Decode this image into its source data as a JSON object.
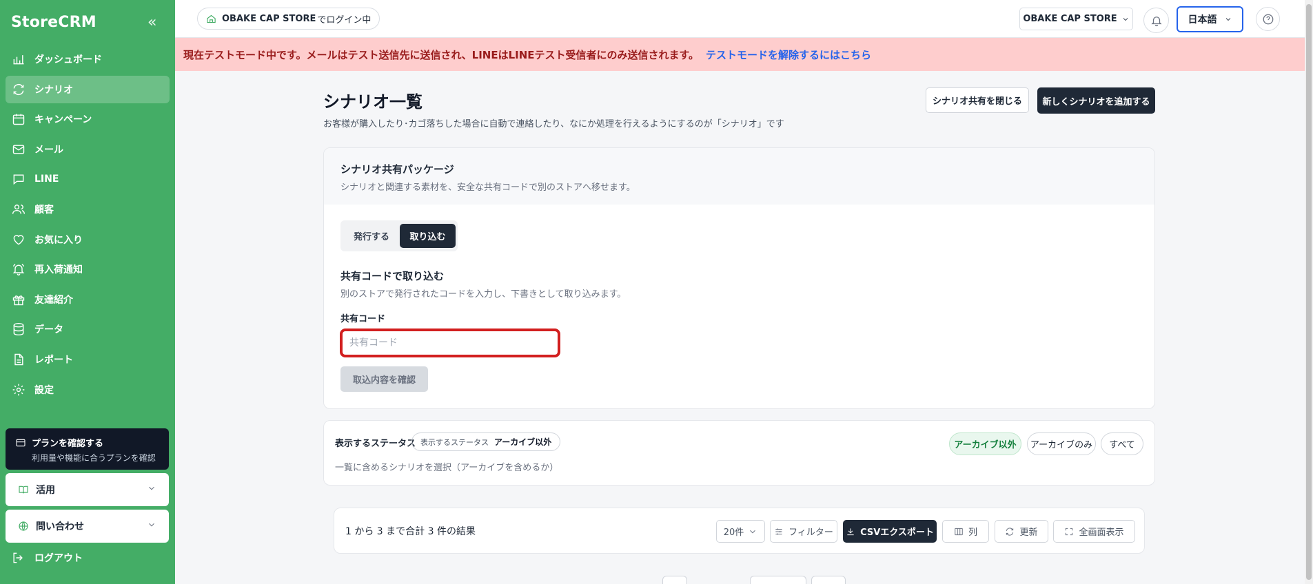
{
  "app": {
    "brand": "StoreCRM",
    "collapse_glyph": "«"
  },
  "sidebar": {
    "items": [
      {
        "label": "ダッシュボード",
        "icon": "bar-chart-icon"
      },
      {
        "label": "シナリオ",
        "icon": "refresh-icon",
        "active": true
      },
      {
        "label": "キャンペーン",
        "icon": "calendar-icon"
      },
      {
        "label": "メール",
        "icon": "mail-icon"
      },
      {
        "label": "LINE",
        "icon": "chat-icon"
      },
      {
        "label": "顧客",
        "icon": "users-icon"
      },
      {
        "label": "お気に入り",
        "icon": "heart-icon"
      },
      {
        "label": "再入荷通知",
        "icon": "bell-ring-icon"
      },
      {
        "label": "友達紹介",
        "icon": "gift-icon"
      },
      {
        "label": "データ",
        "icon": "database-icon"
      },
      {
        "label": "レポート",
        "icon": "file-icon"
      },
      {
        "label": "設定",
        "icon": "gear-icon"
      }
    ],
    "plan": {
      "title": "プランを確認する",
      "subtitle": "利用量や機能に合うプランを確認"
    },
    "usage": {
      "label": "活用"
    },
    "contact": {
      "label": "問い合わせ"
    },
    "logout": {
      "label": "ログアウト"
    }
  },
  "topbar": {
    "store_name": "OBAKE CAP STORE",
    "login_suffix": "でログイン中",
    "store_select": "OBAKE CAP STORE",
    "language": "日本語"
  },
  "banner": {
    "message": "現在テストモード中です。メールはテスト送信先に送信され、LINEはLINEテスト受信者にのみ送信されます。",
    "link": "テストモードを解除するにはこちら"
  },
  "page": {
    "title": "シナリオ一覧",
    "description": "お客様が購入したり･カゴ落ちした場合に自動で連絡したり、なにか処理を行えるようにするのが「シナリオ」です",
    "close_share_button": "シナリオ共有を閉じる",
    "add_button": "新しくシナリオを追加する"
  },
  "share_package": {
    "title": "シナリオ共有パッケージ",
    "subtitle": "シナリオと関連する素材を、安全な共有コードで別のストアへ移せます。",
    "tabs": [
      "発行する",
      "取り込む"
    ],
    "active_tab": "取り込む",
    "import_title": "共有コードで取り込む",
    "import_subtitle": "別のストアで発行されたコードを入力し、下書きとして取り込みます。",
    "code_label": "共有コード",
    "code_placeholder": "共有コード",
    "code_value": "",
    "confirm_button": "取込内容を確認"
  },
  "status_filter": {
    "label": "表示するステータス",
    "badge_prefix": "表示するステータス",
    "badge_value": "アーカイブ以外",
    "description": "一覧に含めるシナリオを選択（アーカイブを含めるか）",
    "options": [
      "アーカイブ以外",
      "アーカイブのみ",
      "すべて"
    ],
    "selected": "アーカイブ以外"
  },
  "table_toolbar": {
    "results": "1 から 3 まで合計 3 件の結果",
    "page_size": "20件",
    "filter": "フィルター",
    "csv_export": "CSVエクスポート",
    "columns": "列",
    "refresh": "更新",
    "fullscreen": "全画面表示"
  },
  "colors": {
    "sidebar": "#44ad66",
    "banner_bg": "#fecdcd",
    "banner_text": "#991b1b",
    "link": "#2563eb",
    "primary_dark": "#1f2937",
    "highlight_border": "#d21f1f"
  }
}
